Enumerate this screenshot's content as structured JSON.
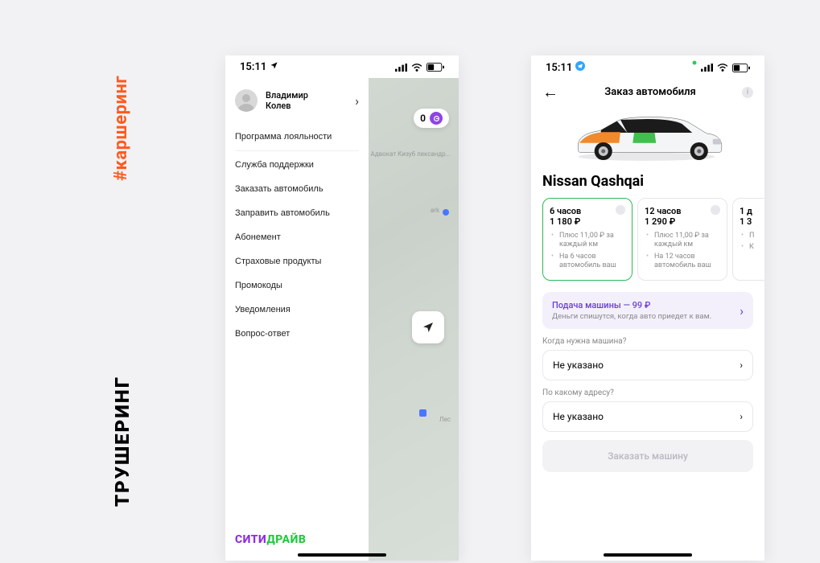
{
  "side": {
    "hashtag": "#каршеринг",
    "trushering": "ТРУШЕРИНГ"
  },
  "status": {
    "time": "15:11"
  },
  "left": {
    "badge_count": "0",
    "profile": {
      "name_line1": "Владимир",
      "name_line2": "Колев"
    },
    "menu": {
      "loyalty": "Программа лояльности",
      "support": "Служба поддержки",
      "order_car": "Заказать автомобиль",
      "refuel": "Заправить автомобиль",
      "subscription": "Абонемент",
      "insurance": "Страховые продукты",
      "promocodes": "Промокоды",
      "notifications": "Уведомления",
      "faq": "Вопрос-ответ"
    },
    "brand": {
      "p1": "СИТИ",
      "p2": "ДРАЙВ"
    },
    "map_labels": {
      "advocate": "Адвокат Кизуб\nлександр...",
      "ark": "ark",
      "lec": "Лес"
    }
  },
  "right": {
    "title": "Заказ автомобиля",
    "car_name": "Nissan Qashqai",
    "tariffs": [
      {
        "label": "6 часов",
        "price": "1 180 ₽",
        "line1": "Плюс 11,00 ₽ за каждый км",
        "line2": "На 6 часов автомобиль ваш"
      },
      {
        "label": "12 часов",
        "price": "1 290 ₽",
        "line1": "Плюс 11,00 ₽ за каждый км",
        "line2": "На 12 часов автомобиль ваш"
      },
      {
        "label": "1 д",
        "price": "1 3",
        "line1": "П",
        "line2": "К"
      }
    ],
    "delivery": {
      "title": "Подача машины — 99 ₽",
      "sub": "Деньги спишутся, когда авто приедет к вам."
    },
    "when_label": "Когда нужна машина?",
    "when_value": "Не указано",
    "where_label": "По какому адресу?",
    "where_value": "Не указано",
    "order_btn": "Заказать машину"
  }
}
